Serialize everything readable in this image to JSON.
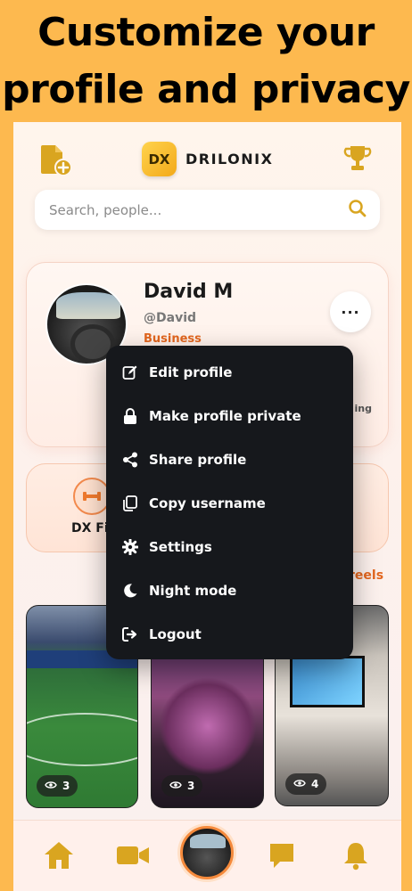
{
  "headline": {
    "line1": "Customize your",
    "line2": "profile and privacy"
  },
  "brand": {
    "logo_text": "DX",
    "name": "DRILONIX"
  },
  "search": {
    "placeholder": "Search, people..."
  },
  "profile": {
    "name": "David M",
    "handle": "@David",
    "account_type": "Business",
    "following_label": "ing",
    "more_label": "···"
  },
  "features": {
    "left_label": "DX Fi"
  },
  "reels_link": "reels",
  "reels": [
    {
      "views": "3"
    },
    {
      "views": "3"
    },
    {
      "views": "4"
    }
  ],
  "menu": [
    {
      "icon": "edit-icon",
      "label": "Edit profile"
    },
    {
      "icon": "lock-icon",
      "label": "Make profile private"
    },
    {
      "icon": "share-icon",
      "label": "Share profile"
    },
    {
      "icon": "copy-icon",
      "label": "Copy username"
    },
    {
      "icon": "gear-icon",
      "label": "Settings"
    },
    {
      "icon": "moon-icon",
      "label": "Night mode"
    },
    {
      "icon": "logout-icon",
      "label": "Logout"
    }
  ],
  "colors": {
    "accent": "#E3661E",
    "gold": "#D9A520",
    "menu_bg": "#16181C",
    "page_bg": "#FDB94F"
  }
}
